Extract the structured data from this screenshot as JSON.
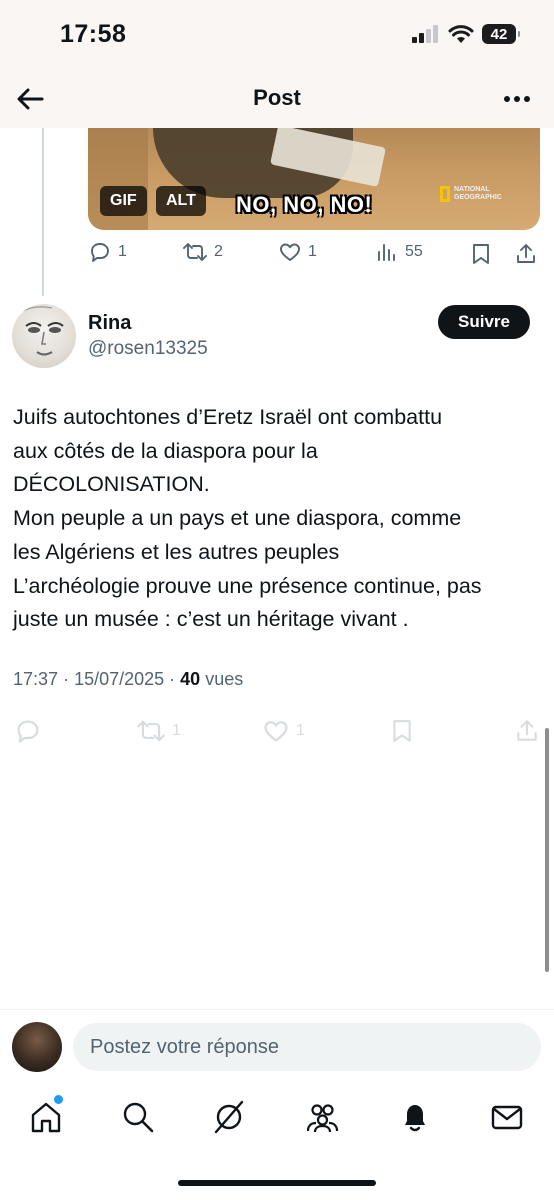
{
  "status": {
    "time": "17:58",
    "battery": "42"
  },
  "header": {
    "title": "Post"
  },
  "prev_tweet": {
    "gif_label": "GIF",
    "alt_label": "ALT",
    "caption": "NO, NO, NO!",
    "watermark": "NATIONAL GEOGRAPHIC",
    "replies": "1",
    "reposts": "2",
    "likes": "1",
    "views": "55"
  },
  "tweet": {
    "author_name": "Rina",
    "author_handle": "@rosen13325",
    "follow_label": "Suivre",
    "lines": [
      "Juifs autochtones d’Eretz Israël ont combattu",
      "aux côtés de la diaspora pour la",
      "DÉCOLONISATION.",
      "Mon peuple a un pays et une diaspora, comme",
      "les Algériens et les autres peuples",
      "L’archéologie prouve une présence continue, pas",
      "juste un musée : c’est un héritage vivant ."
    ],
    "time": "17:37",
    "date": "15/07/2025",
    "views_count": "40",
    "views_label": "vues",
    "reposts": "1",
    "likes": "1"
  },
  "reply": {
    "placeholder": "Postez votre réponse"
  },
  "colors": {
    "text": "#0f1419",
    "muted": "#536471",
    "accent": "#1d9bf0",
    "header_bg": "#faf6f3"
  },
  "icons": [
    "back-arrow-icon",
    "more-icon",
    "reply-icon",
    "repost-icon",
    "like-icon",
    "views-icon",
    "bookmark-icon",
    "share-icon",
    "home-icon",
    "search-icon",
    "grok-icon",
    "communities-icon",
    "notifications-icon",
    "messages-icon"
  ]
}
